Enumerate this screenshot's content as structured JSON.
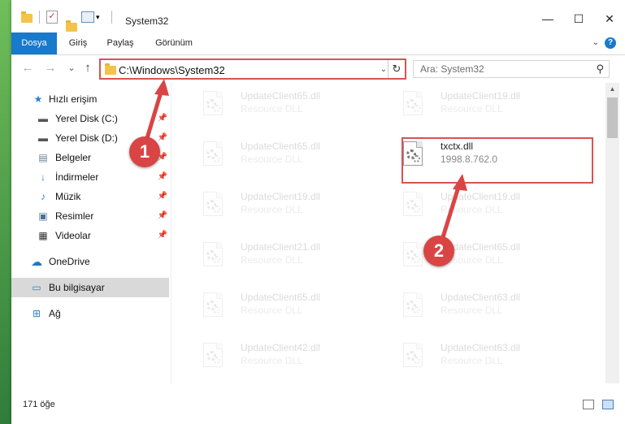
{
  "window": {
    "title": "System32",
    "controls": {
      "minimize": "—",
      "maximize": "☐",
      "close": "✕"
    }
  },
  "ribbon": {
    "tabs": [
      "Dosya",
      "Giriş",
      "Paylaş",
      "Görünüm"
    ],
    "help": "?"
  },
  "navigation": {
    "back": "←",
    "forward": "→",
    "recent": "⌄",
    "up": "↑",
    "address": "C:\\Windows\\System32",
    "refresh": "↻",
    "search_placeholder": "Ara: System32"
  },
  "sidebar": {
    "items": [
      {
        "label": "Hızlı erişim",
        "icon": "star-icon"
      },
      {
        "label": "Yerel Disk (C:)",
        "icon": "drive-icon",
        "pinned": true
      },
      {
        "label": "Yerel Disk (D:)",
        "icon": "drive-icon",
        "pinned": true
      },
      {
        "label": "Belgeler",
        "icon": "documents-icon",
        "pinned": true
      },
      {
        "label": "İndirmeler",
        "icon": "download-icon",
        "pinned": true
      },
      {
        "label": "Müzik",
        "icon": "music-icon",
        "pinned": true
      },
      {
        "label": "Resimler",
        "icon": "pictures-icon",
        "pinned": true
      },
      {
        "label": "Videolar",
        "icon": "video-icon",
        "pinned": true
      },
      {
        "label": "OneDrive",
        "icon": "cloud-icon"
      },
      {
        "label": "Bu bilgisayar",
        "icon": "computer-icon",
        "selected": true
      },
      {
        "label": "Ağ",
        "icon": "network-icon"
      }
    ]
  },
  "files": {
    "left_column": [
      {
        "name": "UpdateClient65.dll",
        "type": "Resource DLL"
      },
      {
        "name": "UpdateClient65.dll",
        "type": "Resource DLL"
      },
      {
        "name": "UpdateClient19.dll",
        "type": "Resource DLL"
      },
      {
        "name": "UpdateClient21.dll",
        "type": "Resource DLL"
      },
      {
        "name": "UpdateClient65.dll",
        "type": "Resource DLL"
      },
      {
        "name": "UpdateClient42.dll",
        "type": "Resource DLL"
      }
    ],
    "right_column": [
      {
        "name": "UpdateClient19.dll",
        "type": "Resource DLL"
      },
      {
        "name": "txctx.dll",
        "type": "1998.8.762.0",
        "highlighted": true
      },
      {
        "name": "UpdateClient19.dll",
        "type": "Resource DLL"
      },
      {
        "name": "UpdateClient65.dll",
        "type": "Resource DLL"
      },
      {
        "name": "UpdateClient63.dll",
        "type": "Resource DLL"
      },
      {
        "name": "UpdateClient63.dll",
        "type": "Resource DLL"
      }
    ]
  },
  "status": {
    "item_count": "171 öğe"
  },
  "annotations": {
    "step1": "1",
    "step2": "2",
    "color": "#d94545"
  }
}
